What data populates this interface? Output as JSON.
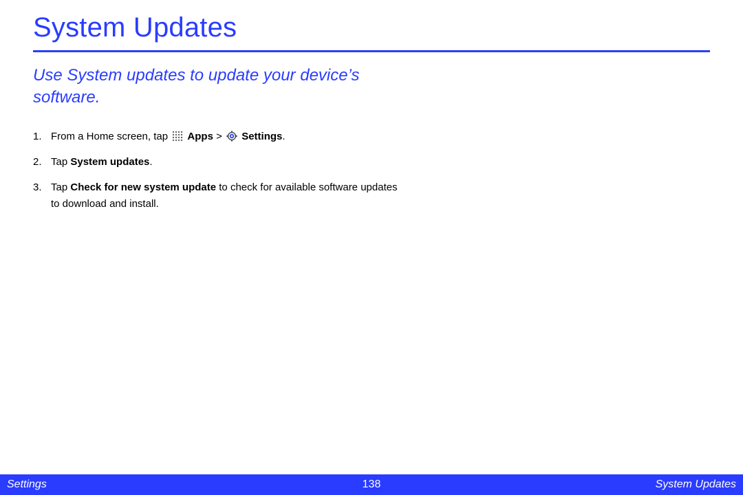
{
  "title": "System Updates",
  "intro": "Use System updates to update your device’s software.",
  "steps": {
    "s1": {
      "pre": "From a Home screen, tap ",
      "apps_label": "Apps",
      "sep": " > ",
      "settings_label": "Settings",
      "post": "."
    },
    "s2": {
      "pre": "Tap ",
      "bold": "System updates",
      "post": "."
    },
    "s3": {
      "pre": "Tap ",
      "bold": "Check for new system update",
      "mid": " to check for available software updates to download and install."
    }
  },
  "footer": {
    "left": "Settings",
    "page": "138",
    "right": "System Updates"
  },
  "colors": {
    "accent": "#2a3cff"
  }
}
